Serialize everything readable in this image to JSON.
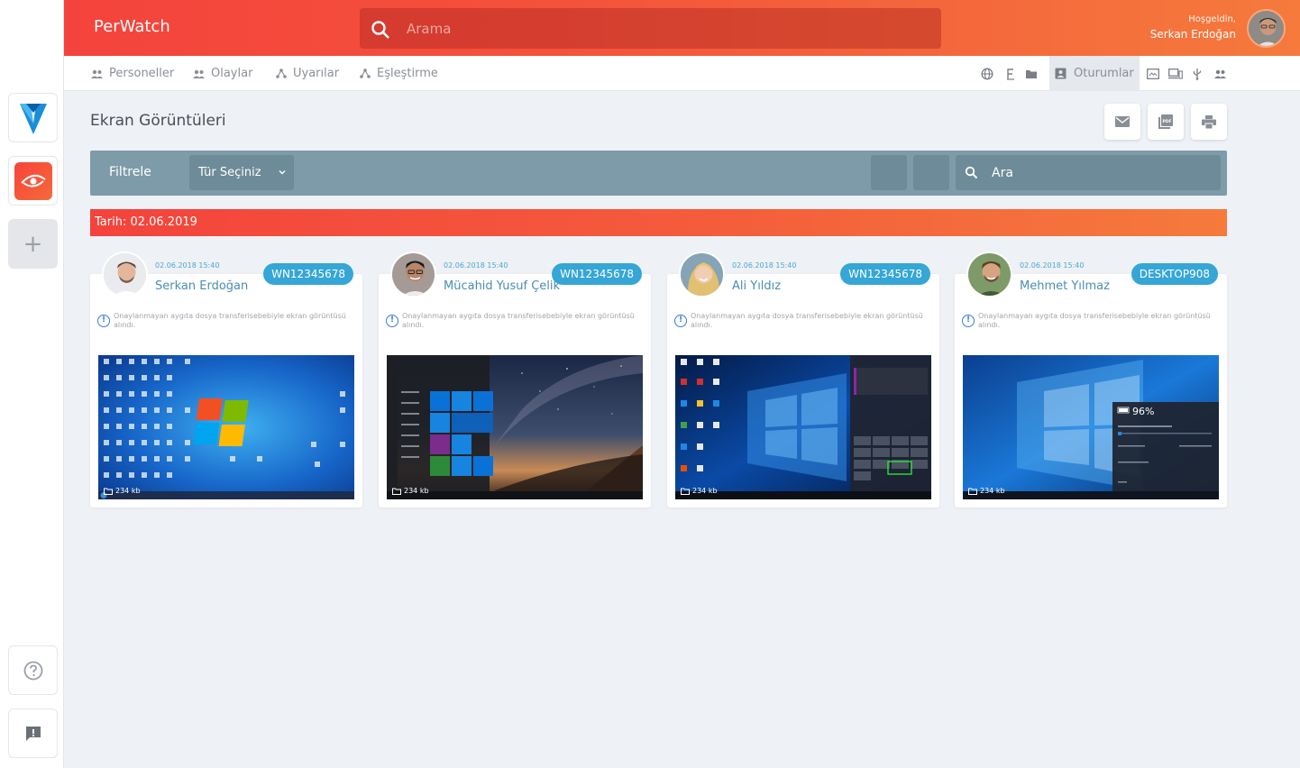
{
  "header": {
    "brand": "PerWatch",
    "search_placeholder": "Arama",
    "welcome": "Hoşgeldin,",
    "user_name": "Serkan Erdoğan"
  },
  "nav": {
    "items": [
      {
        "label": "Personeller"
      },
      {
        "label": "Olaylar"
      },
      {
        "label": "Uyarılar"
      },
      {
        "label": "Eşleştirme"
      }
    ],
    "active_label": "Oturumlar",
    "icons": [
      "globe-icon",
      "font-icon",
      "folder-icon",
      "sessions-icon",
      "screen-icon",
      "devices-icon",
      "usb-icon",
      "users-icon"
    ]
  },
  "page": {
    "title": "Ekran Görüntüleri"
  },
  "filter": {
    "label": "Filtrele",
    "type_select": "Tür Seçiniz",
    "search_placeholder": "Ara"
  },
  "date_bar": "Tarih: 02.06.2019",
  "cards": [
    {
      "date": "02.06.2018 15:40",
      "name": "Serkan Erdoğan",
      "badge": "WN12345678",
      "warning": "Onaylanmayan aygıta dosya transferisebebiyle ekran görüntüsü alındı.",
      "size": "234 kb"
    },
    {
      "date": "02.06.2018 15:40",
      "name": "Mücahid Yusuf Çelik",
      "badge": "WN12345678",
      "warning": "Onaylanmayan aygıta dosya transferisebebiyle ekran görüntüsü alındı.",
      "size": "234 kb"
    },
    {
      "date": "02.06.2018 15:40",
      "name": "Ali Yıldız",
      "badge": "WN12345678",
      "warning": "Onaylanmayan aygıta dosya transferisebebiyle ekran görüntüsü alındı.",
      "size": "234 kb"
    },
    {
      "date": "02.06.2018 15:40",
      "name": "Mehmet Yılmaz",
      "badge": "DESKTOP908",
      "warning": "Onaylanmayan aygıta dosya transferisebebiyle ekran görüntüsü alındı.",
      "size": "234 kb"
    }
  ],
  "screenshot_text": {
    "battery": "96%"
  },
  "colors": {
    "accent_red": "#f4433c",
    "accent_orange": "#f57a3c",
    "badge_blue": "#35a6d6",
    "filter_bar": "#7e9ba9"
  }
}
